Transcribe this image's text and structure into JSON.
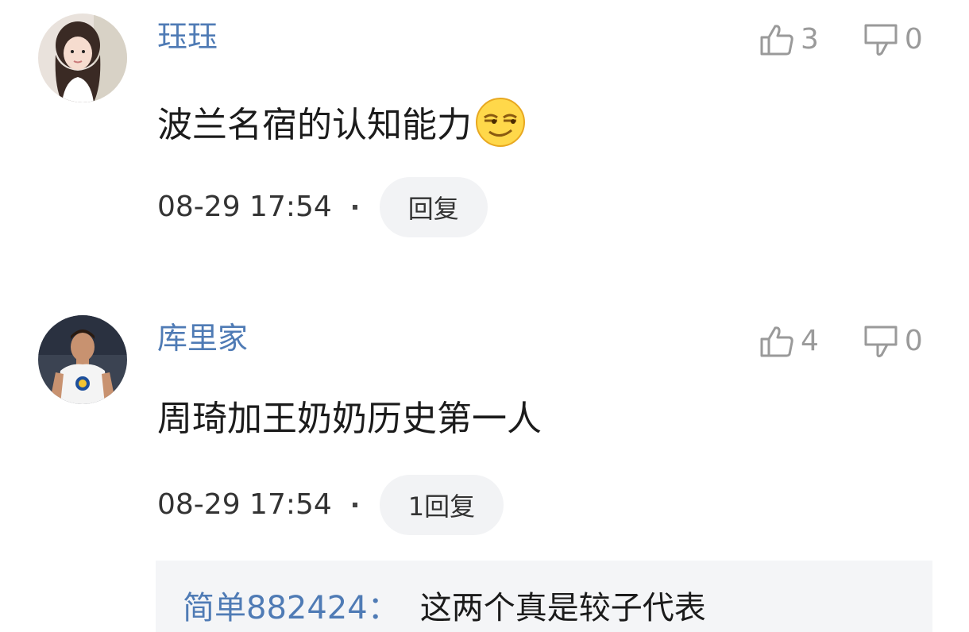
{
  "comments": [
    {
      "username": "珏珏",
      "likes": "3",
      "dislikes": "0",
      "text": "波兰名宿的认知能力",
      "emoji": "smirk-emoji",
      "time": "08-29 17:54",
      "reply_label": "回复"
    },
    {
      "username": "库里家",
      "likes": "4",
      "dislikes": "0",
      "text": "周琦加王奶奶历史第一人",
      "time": "08-29 17:54",
      "reply_label": "1回复"
    }
  ],
  "sub_reply": {
    "username": "简单882424：",
    "text": "这两个真是较子代表"
  },
  "colors": {
    "username": "#4f7bb5",
    "icon_gray": "#9a9a9a",
    "reply_bg": "#f2f3f5"
  }
}
